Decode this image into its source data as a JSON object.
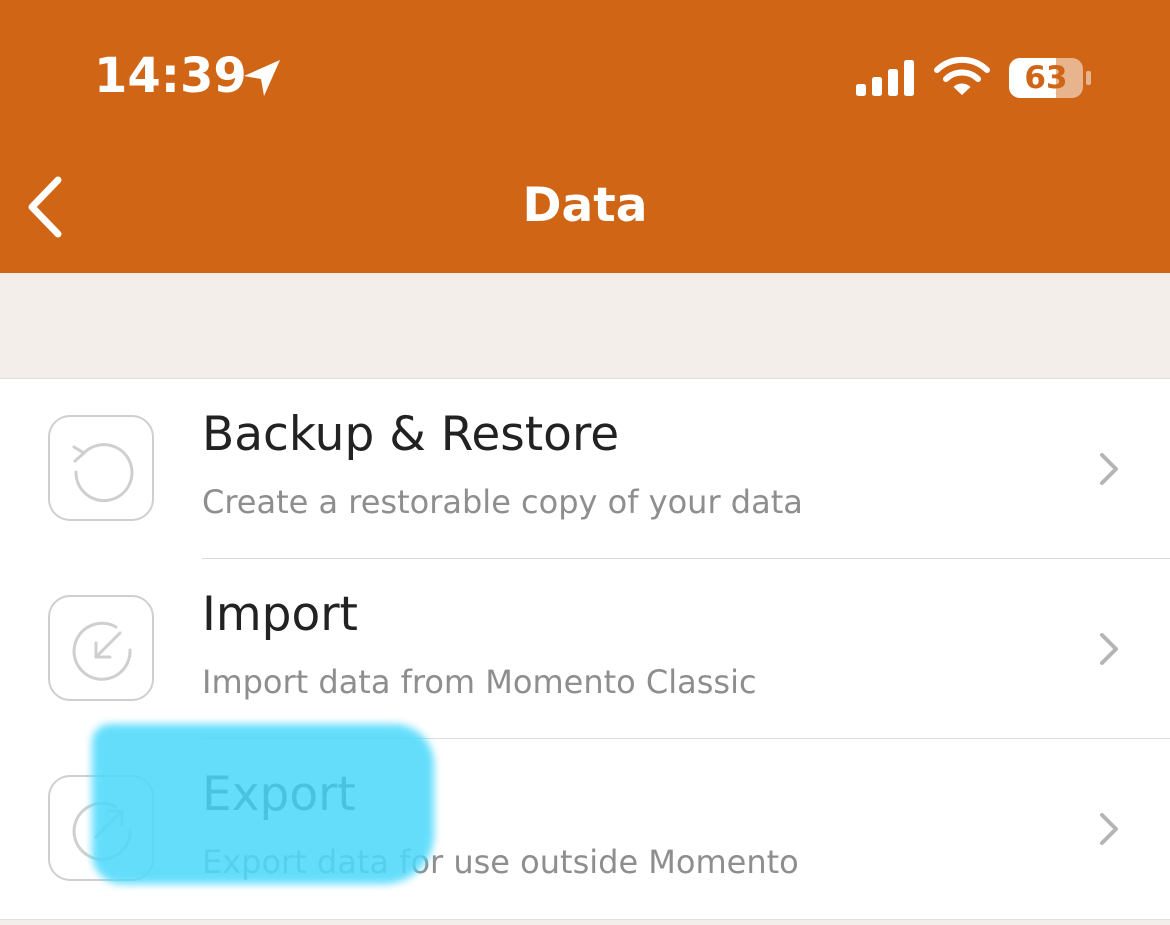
{
  "status_bar": {
    "time": "14:39",
    "battery": "63",
    "icons": [
      "location-arrow-icon",
      "cellular-signal-icon",
      "wifi-icon",
      "battery-icon"
    ]
  },
  "nav": {
    "title": "Data",
    "back_icon": "chevron-left-icon"
  },
  "colors": {
    "header": "#d06516",
    "background": "#f3eeea",
    "highlight": "#4fd9fb"
  },
  "rows": [
    {
      "title": "Backup & Restore",
      "subtitle": "Create a restorable copy of your data",
      "icon": "restore-icon"
    },
    {
      "title": "Import",
      "subtitle": "Import data from Momento Classic",
      "icon": "import-icon"
    },
    {
      "title": "Export",
      "subtitle": "Export data for use outside Momento",
      "icon": "export-icon"
    }
  ]
}
